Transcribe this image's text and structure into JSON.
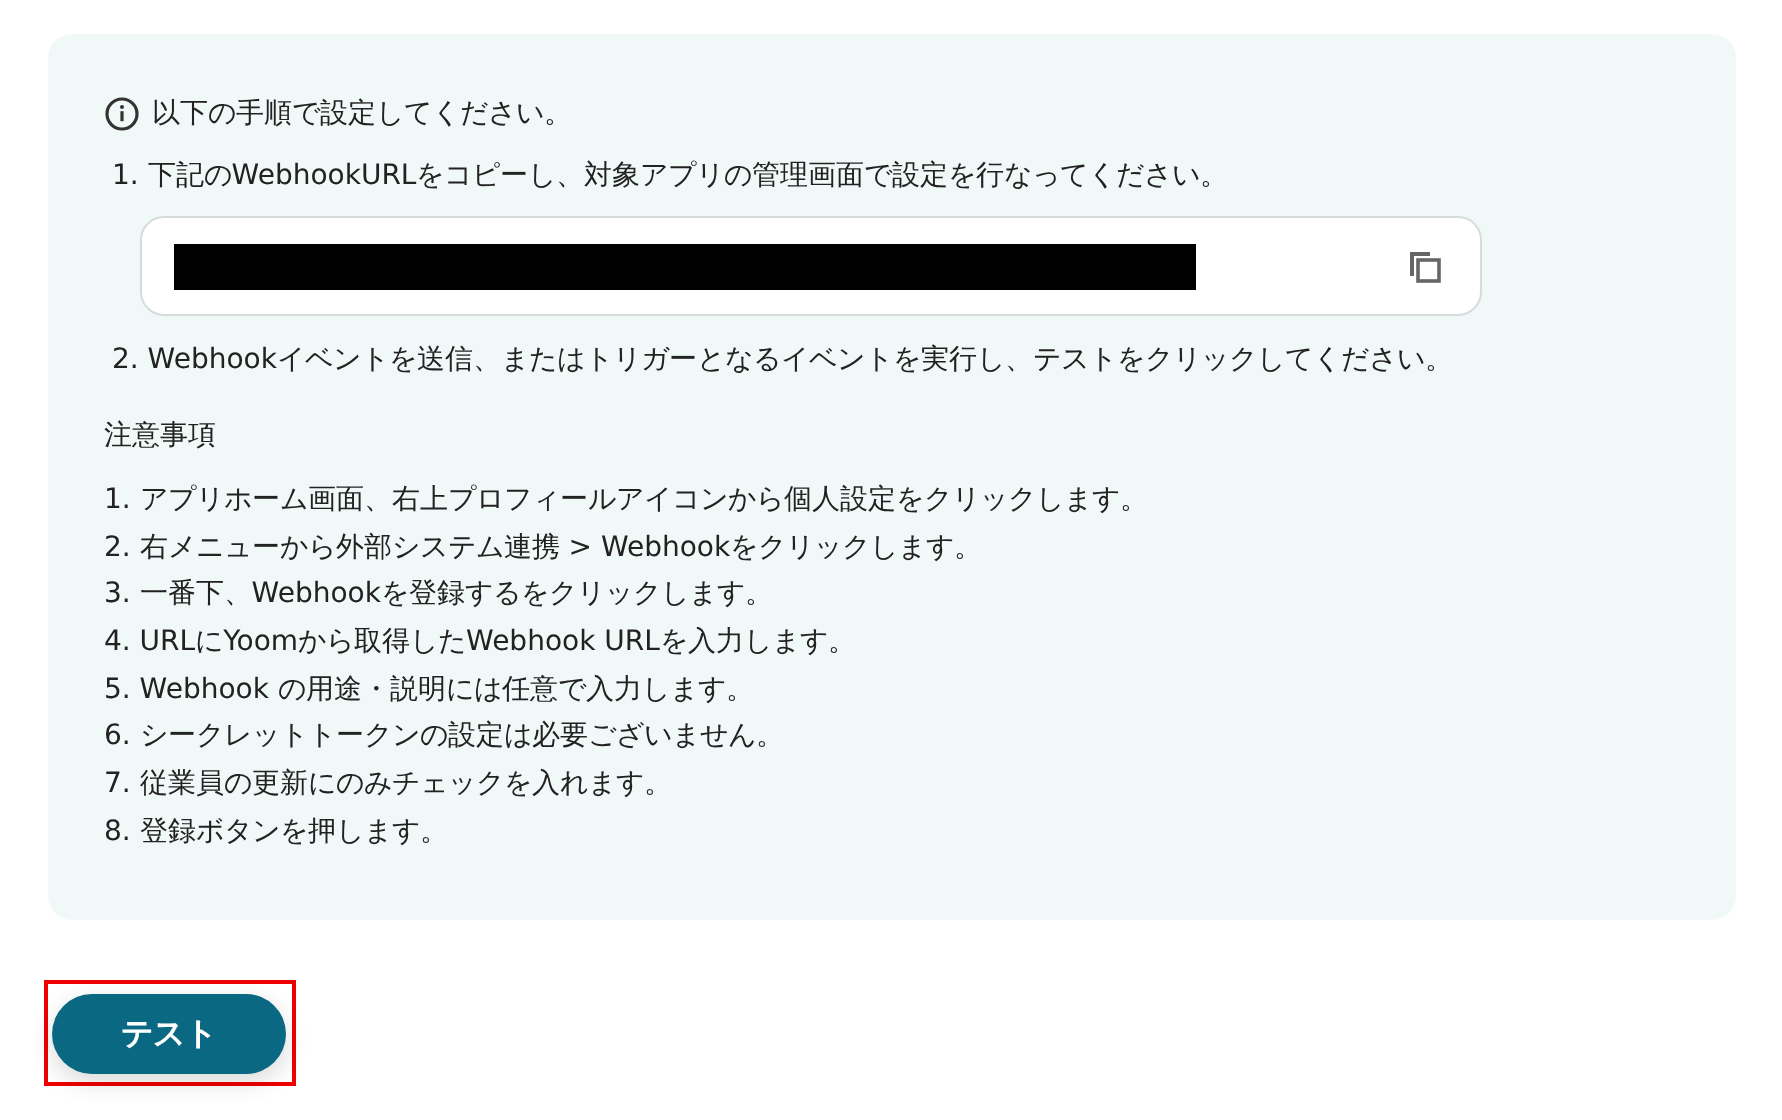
{
  "instructions": {
    "title": "以下の手順で設定してください。",
    "steps": [
      "1. 下記のWebhookURLをコピーし、対象アプリの管理画面で設定を行なってください。",
      "2. Webhookイベントを送信、またはトリガーとなるイベントを実行し、テストをクリックしてください。"
    ],
    "url_field": {
      "redacted": true
    }
  },
  "notes": {
    "heading": "注意事項",
    "items": [
      "1. アプリホーム画面、右上プロフィールアイコンから個人設定をクリックします。",
      "2. 右メニューから外部システム連携 > Webhookをクリックします。",
      "3. 一番下、Webhookを登録するをクリックします。",
      "4. URLにYoomから取得したWebhook URLを入力します。",
      "5. Webhook の用途・説明には任意で入力します。",
      "6. シークレットトークンの設定は必要ございません。",
      "7. 従業員の更新にのみチェックを入れます。",
      "8. 登録ボタンを押します。"
    ]
  },
  "test_button": {
    "label": "テスト",
    "highlighted": true
  }
}
